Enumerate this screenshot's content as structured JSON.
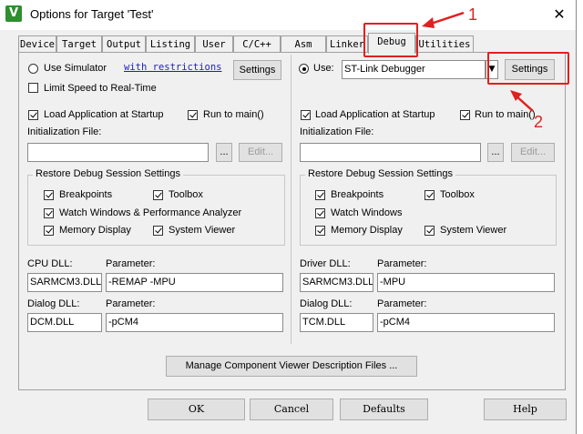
{
  "window": {
    "title": "Options for Target 'Test'",
    "close": "✕"
  },
  "tabs": [
    "Device",
    "Target",
    "Output",
    "Listing",
    "User",
    "C/C++",
    "Asm",
    "Linker",
    "Debug",
    "Utilities"
  ],
  "active_tab": "Debug",
  "left": {
    "use_simulator": "Use Simulator",
    "with_restrictions": "with restrictions",
    "settings": "Settings",
    "limit_speed": "Limit Speed to Real-Time",
    "load_app": "Load Application at Startup",
    "run_to_main": "Run to main()",
    "init_file_label": "Initialization File:",
    "browse": "...",
    "edit": "Edit...",
    "restore_group": "Restore Debug Session Settings",
    "breakpoints": "Breakpoints",
    "toolbox": "Toolbox",
    "watch": "Watch Windows & Performance Analyzer",
    "memory": "Memory Display",
    "system_viewer": "System Viewer",
    "cpu_dll_label": "CPU DLL:",
    "cpu_param_label": "Parameter:",
    "cpu_dll": "SARMCM3.DLL",
    "cpu_param": "-REMAP -MPU",
    "dialog_dll_label": "Dialog DLL:",
    "dialog_param_label": "Parameter:",
    "dialog_dll": "DCM.DLL",
    "dialog_param": "-pCM4"
  },
  "right": {
    "use": "Use:",
    "debugger": "ST-Link Debugger",
    "settings": "Settings",
    "load_app": "Load Application at Startup",
    "run_to_main": "Run to main()",
    "init_file_label": "Initialization File:",
    "browse": "...",
    "edit": "Edit...",
    "restore_group": "Restore Debug Session Settings",
    "breakpoints": "Breakpoints",
    "toolbox": "Toolbox",
    "watch": "Watch Windows",
    "memory": "Memory Display",
    "system_viewer": "System Viewer",
    "driver_dll_label": "Driver DLL:",
    "driver_param_label": "Parameter:",
    "driver_dll": "SARMCM3.DLL",
    "driver_param": "-MPU",
    "dialog_dll_label": "Dialog DLL:",
    "dialog_param_label": "Parameter:",
    "dialog_dll": "TCM.DLL",
    "dialog_param": "-pCM4"
  },
  "manage_button": "Manage Component Viewer Description Files ...",
  "footer": {
    "ok": "OK",
    "cancel": "Cancel",
    "defaults": "Defaults",
    "help": "Help"
  },
  "annotations": {
    "label1": "1",
    "label2": "2",
    "color": "#e02020"
  }
}
